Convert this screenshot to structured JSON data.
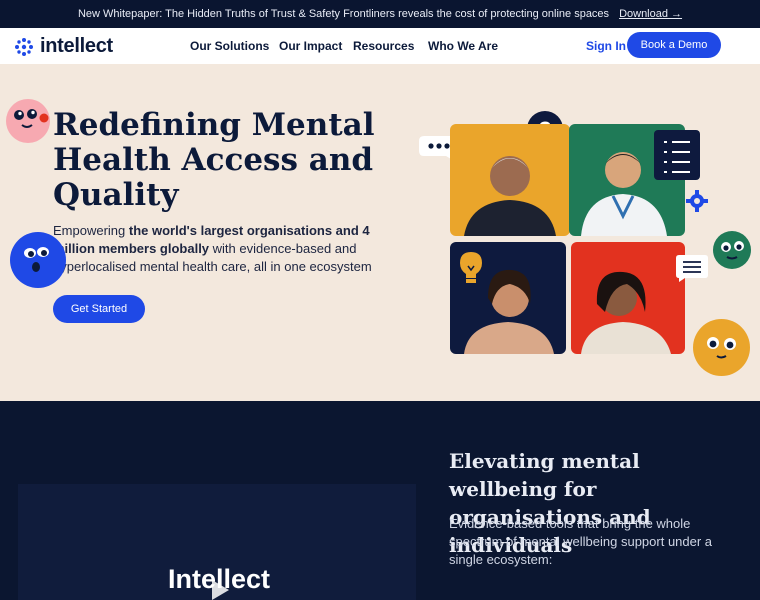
{
  "banner": {
    "text": "New Whitepaper: The Hidden Truths of Trust & Safety Frontliners reveals the cost of protecting online spaces",
    "link": "Download →"
  },
  "nav": {
    "logo": "intellect",
    "items": [
      "Our Solutions",
      "Our Impact",
      "Resources",
      "Who We Are"
    ],
    "sign_in": "Sign In",
    "demo": "Book a Demo"
  },
  "hero": {
    "title": "Redefining Mental Health Access and Quality",
    "subtitle_parts": [
      "Empowering ",
      "the world's largest organisations and 4 million members globally",
      " with evidence-based and hyperlocalised mental health care, all in one ecosystem"
    ],
    "cta": "Get Started",
    "question_mark": "?"
  },
  "section2": {
    "video_title": "Intellect",
    "title": "Elevating mental wellbeing for organisations and individuals",
    "subtitle": "Evidence-based tools that bring the whole spectrum of mental wellbeing support under a single ecosystem:"
  },
  "colors": {
    "accent": "#1f49e6",
    "dark": "#0b1630",
    "cream": "#f3e8dd",
    "orange": "#eaa52b",
    "green": "#1f7a57",
    "navy_tile": "#0e1a3e",
    "red": "#e2321f"
  }
}
